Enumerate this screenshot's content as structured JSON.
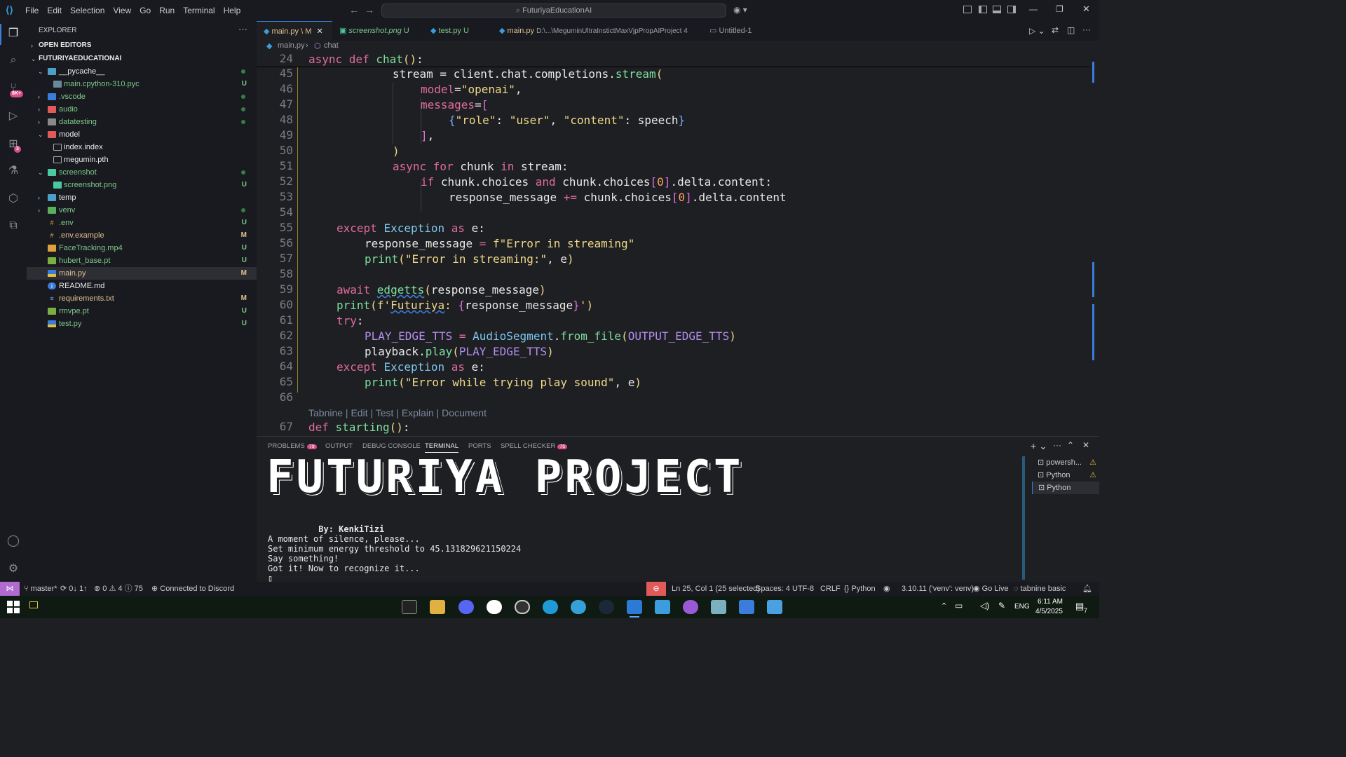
{
  "titlebar": {
    "menu": [
      "File",
      "Edit",
      "Selection",
      "View",
      "Go",
      "Run",
      "Terminal",
      "Help"
    ],
    "search": "FuturiyaEducationAI"
  },
  "activity": {
    "source_badge": "8K+",
    "ext_badge": "3"
  },
  "sidebar": {
    "title": "EXPLORER",
    "open_editors": "OPEN EDITORS",
    "project": "FUTURIYAEDUCATIONAI",
    "tree": [
      {
        "name": "__pycache__",
        "status": ""
      },
      {
        "name": "main.cpython-310.pyc",
        "status": "U"
      },
      {
        "name": ".vscode",
        "status": ""
      },
      {
        "name": "audio",
        "status": ""
      },
      {
        "name": "datatesting",
        "status": ""
      },
      {
        "name": "model",
        "status": ""
      },
      {
        "name": "index.index",
        "status": ""
      },
      {
        "name": "megumin.pth",
        "status": ""
      },
      {
        "name": "screenshot",
        "status": ""
      },
      {
        "name": "screenshot.png",
        "status": "U"
      },
      {
        "name": "temp",
        "status": ""
      },
      {
        "name": "venv",
        "status": ""
      },
      {
        "name": ".env",
        "status": "U"
      },
      {
        "name": ".env.example",
        "status": "M"
      },
      {
        "name": "FaceTracking.mp4",
        "status": "U"
      },
      {
        "name": "hubert_base.pt",
        "status": "U"
      },
      {
        "name": "main.py",
        "status": "M"
      },
      {
        "name": "README.md",
        "status": ""
      },
      {
        "name": "requirements.txt",
        "status": "M"
      },
      {
        "name": "rmvpe.pt",
        "status": "U"
      },
      {
        "name": "test.py",
        "status": "U"
      }
    ]
  },
  "tabs": [
    {
      "label": "main.py",
      "extra": "\\ M"
    },
    {
      "label": "screenshot.png",
      "extra": "U"
    },
    {
      "label": "test.py",
      "extra": "U"
    },
    {
      "label": "main.py",
      "extra": "D:\\...\\MeguminUltraInstictMaxVjpPropAIProject 4"
    },
    {
      "label": "Untitled-1",
      "extra": ""
    }
  ],
  "breadcrumb": {
    "file": "main.py",
    "symbol": "chat"
  },
  "editor": {
    "line_numbers": [
      "24",
      "45",
      "46",
      "47",
      "48",
      "49",
      "50",
      "51",
      "52",
      "53",
      "54",
      "55",
      "56",
      "57",
      "58",
      "59",
      "60",
      "61",
      "62",
      "63",
      "64",
      "65",
      "66",
      "67"
    ],
    "codelens": "Tabnine | Edit | Test | Explain | Document"
  },
  "panel": {
    "tabs": [
      "PROBLEMS",
      "OUTPUT",
      "DEBUG CONSOLE",
      "TERMINAL",
      "PORTS",
      "SPELL CHECKER"
    ],
    "problems_count": "79",
    "spell_count": "75",
    "banner": "FUTURIYA PROJECT",
    "terminal_lines": [
      "          By: KenkiTizi",
      "A moment of silence, please...",
      "Set minimum energy threshold to 45.131829621150224",
      "Say something!",
      "Got it! Now to recognize it...",
      "▯"
    ],
    "terminals": [
      "powersh...",
      "Python",
      "Python"
    ]
  },
  "statusbar": {
    "branch": "master*",
    "sync": "0↓ 1↑",
    "errors": "0",
    "warnings": "4",
    "info": "75",
    "discord": "Connected to Discord",
    "position": "Ln 25, Col 1 (25 selected)",
    "spaces": "Spaces: 4",
    "encoding": "UTF-8",
    "eol": "CRLF",
    "language": "Python",
    "interpreter": "3.10.11 ('venv': venv)",
    "golive": "Go Live",
    "tabnine": "tabnine basic"
  },
  "taskbar": {
    "lang": "ENG",
    "time": "6:11 AM",
    "date": "4/5/2025",
    "notifications": "7"
  },
  "colors": {
    "accent": "#3b7ddd",
    "keyword": "#e06c9f",
    "string": "#f0d98a",
    "function": "#7ee0a0"
  }
}
